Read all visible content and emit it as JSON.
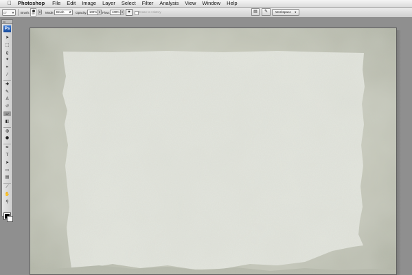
{
  "menubar": {
    "apple_icon": "apple-logo-icon",
    "app_name": "Photoshop",
    "items": [
      "File",
      "Edit",
      "Image",
      "Layer",
      "Select",
      "Filter",
      "Analysis",
      "View",
      "Window",
      "Help"
    ]
  },
  "options": {
    "brush_label": "Brush:",
    "brush_size": "60",
    "mode_label": "Mode:",
    "mode_value": "Brush",
    "opacity_label": "Opacity:",
    "opacity_value": "100%",
    "flow_label": "Flow:",
    "flow_value": "100%",
    "erase_label": "Erase to History",
    "workspace_label": "Workspace"
  },
  "toolbox": {
    "logo": "Ps",
    "tools": [
      {
        "name": "move-tool-icon",
        "glyph": "➤"
      },
      {
        "name": "marquee-tool-icon",
        "glyph": "⬚"
      },
      {
        "name": "lasso-tool-icon",
        "glyph": "ϱ"
      },
      {
        "name": "magic-wand-tool-icon",
        "glyph": "✦"
      },
      {
        "name": "crop-tool-icon",
        "glyph": "⌗"
      },
      {
        "name": "slice-tool-icon",
        "glyph": "⁄"
      },
      {
        "name": "healing-brush-tool-icon",
        "glyph": "✚"
      },
      {
        "name": "brush-tool-icon",
        "glyph": "✎"
      },
      {
        "name": "clone-stamp-tool-icon",
        "glyph": "♙"
      },
      {
        "name": "history-brush-tool-icon",
        "glyph": "↺"
      },
      {
        "name": "eraser-tool-icon",
        "glyph": "▱",
        "active": true
      },
      {
        "name": "gradient-tool-icon",
        "glyph": "◧"
      },
      {
        "name": "blur-tool-icon",
        "glyph": "◍"
      },
      {
        "name": "dodge-tool-icon",
        "glyph": "●"
      },
      {
        "name": "pen-tool-icon",
        "glyph": "✒"
      },
      {
        "name": "type-tool-icon",
        "glyph": "T"
      },
      {
        "name": "path-selection-tool-icon",
        "glyph": "➤"
      },
      {
        "name": "shape-tool-icon",
        "glyph": "▭"
      },
      {
        "name": "notes-tool-icon",
        "glyph": "▤"
      },
      {
        "name": "eyedropper-tool-icon",
        "glyph": "⟋"
      },
      {
        "name": "hand-tool-icon",
        "glyph": "✋"
      },
      {
        "name": "zoom-tool-icon",
        "glyph": "⚲"
      }
    ]
  },
  "colors": {
    "paper": "#e4e6df",
    "paper_border": "#b9bcaf",
    "workspace_bg": "#8f8f8f",
    "logo_blue": "#2a62c0"
  }
}
